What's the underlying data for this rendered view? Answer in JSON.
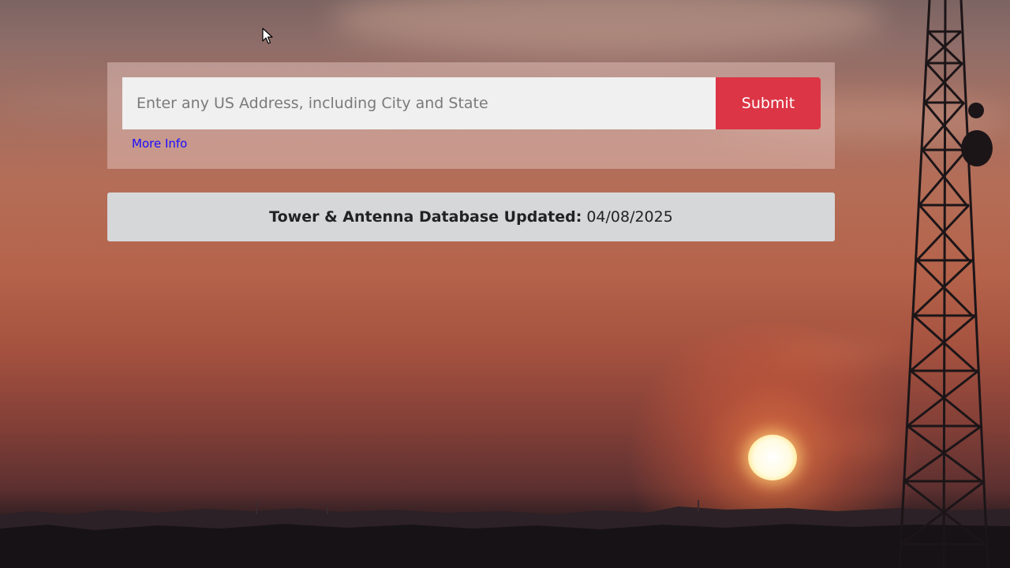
{
  "search": {
    "placeholder": "Enter any US Address, including City and State",
    "value": "",
    "submit_label": "Submit",
    "more_info_label": "More Info"
  },
  "banner": {
    "label": "Tower & Antenna Database Updated:",
    "date": "04/08/2025"
  },
  "colors": {
    "submit": "#dc3545",
    "link": "#1a0dff",
    "banner_bg": "#d6d7d9"
  },
  "background": {
    "scene": "sunset-sky-with-radio-tower"
  },
  "icons": {
    "cursor": "mouse-pointer-icon"
  }
}
